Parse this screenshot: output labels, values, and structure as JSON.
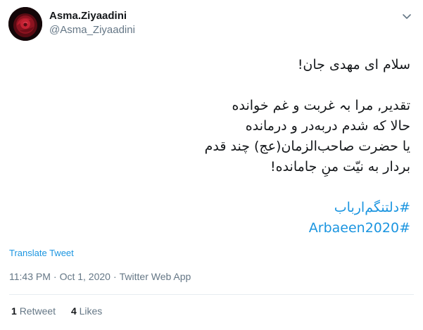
{
  "user": {
    "display_name": "Asma.Ziyaadini",
    "handle": "@Asma_Ziyaadini",
    "avatar_icon": "red-rose-avatar"
  },
  "more_icon": "chevron-down-icon",
  "tweet": {
    "lines": [
      "سلام ای مهدی جان!",
      "",
      "تقدیر, مرا بہ غربت و غم خوانده",
      "حالا که شدم دربه‌در و درمانده",
      "یا حضرت صاحب‌الزمان(عج) چند قدم",
      "بردار به نیّت منِ جامانده!",
      ""
    ],
    "hashtags": [
      "#دلتنگم‌ارباب",
      "#Arbaeen2020"
    ]
  },
  "translate_label": "Translate Tweet",
  "meta": {
    "time": "11:43 PM",
    "date": "Oct 1, 2020",
    "source": "Twitter Web App",
    "separator": "·"
  },
  "stats": {
    "retweets_count": "1",
    "retweets_label": "Retweet",
    "likes_count": "4",
    "likes_label": "Likes"
  },
  "colors": {
    "text": "#14171a",
    "secondary": "#657786",
    "link": "#1b95e0",
    "divider": "#e6ecf0"
  }
}
